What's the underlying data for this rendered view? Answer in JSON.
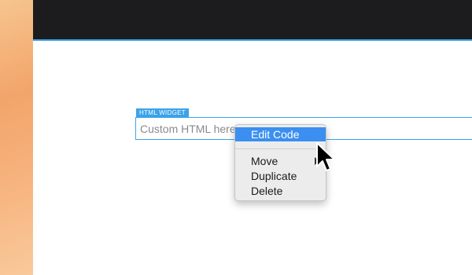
{
  "widget": {
    "tag_label": "HTML WIDGET",
    "placeholder": "Custom HTML here"
  },
  "context_menu": {
    "items": [
      {
        "label": "Edit Code",
        "highlighted": true
      },
      {
        "label": "Move",
        "has_submenu": true
      },
      {
        "label": "Duplicate"
      },
      {
        "label": "Delete"
      }
    ]
  },
  "colors": {
    "accent": "#3ba3e8",
    "menu_highlight": "#3b8ff0",
    "toolbar": "#1c1c1e",
    "desktop": "#f2a56a"
  },
  "icons": {
    "cursor": "mouse-pointer-icon",
    "submenu": "chevron-right-icon"
  }
}
